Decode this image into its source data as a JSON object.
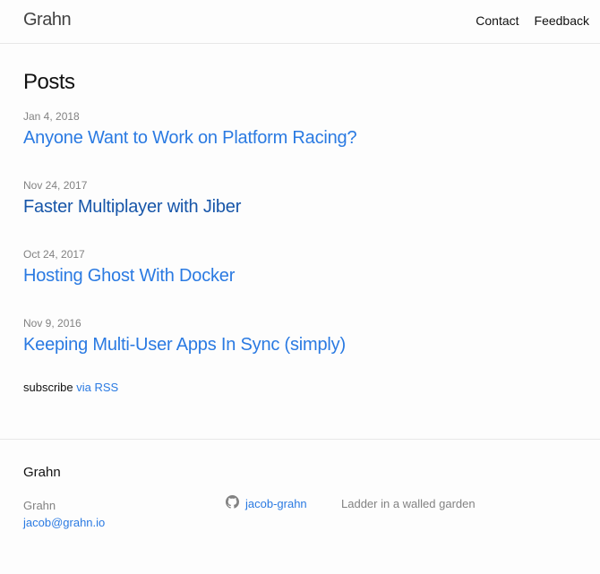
{
  "header": {
    "site_title": "Grahn",
    "nav": [
      "Contact",
      "Feedback"
    ]
  },
  "main": {
    "heading": "Posts",
    "posts": [
      {
        "date": "Jan 4, 2018",
        "title": "Anyone Want to Work on Platform Racing?"
      },
      {
        "date": "Nov 24, 2017",
        "title": "Faster Multiplayer with Jiber"
      },
      {
        "date": "Oct 24, 2017",
        "title": "Hosting Ghost With Docker"
      },
      {
        "date": "Nov 9, 2016",
        "title": "Keeping Multi-User Apps In Sync (simply)"
      }
    ],
    "subscribe_text": "subscribe",
    "subscribe_link": "via RSS"
  },
  "footer": {
    "heading": "Grahn",
    "name": "Grahn",
    "email": "jacob@grahn.io",
    "github_icon": "github-icon",
    "github_user": "jacob-grahn",
    "tagline": "Ladder in a walled garden"
  },
  "colors": {
    "link": "#2a7ae2",
    "visited": "#1756a9",
    "muted": "#828282"
  }
}
